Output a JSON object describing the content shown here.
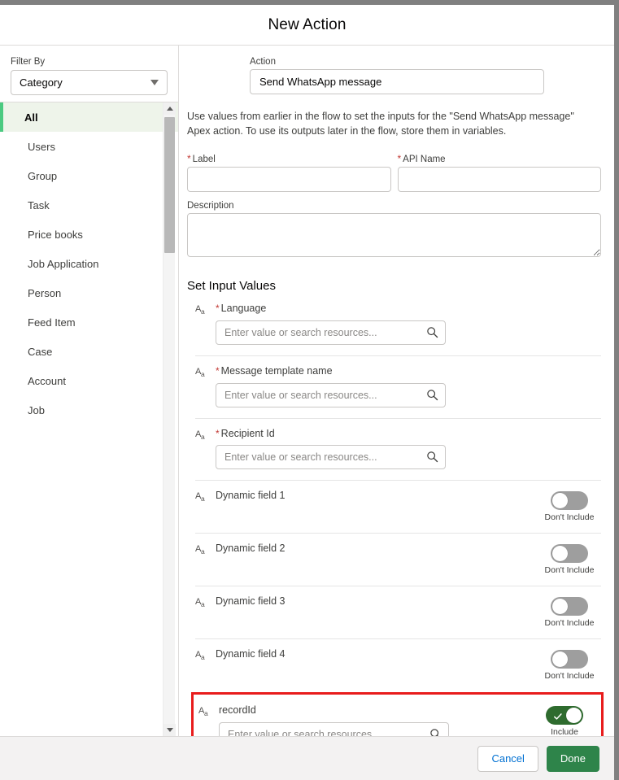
{
  "header": {
    "title": "New Action"
  },
  "sidebar": {
    "filter_label": "Filter By",
    "filter_value": "Category",
    "items": [
      {
        "label": "All",
        "selected": true
      },
      {
        "label": "Users",
        "selected": false
      },
      {
        "label": "Group",
        "selected": false
      },
      {
        "label": "Task",
        "selected": false
      },
      {
        "label": "Price books",
        "selected": false
      },
      {
        "label": "Job Application",
        "selected": false
      },
      {
        "label": "Person",
        "selected": false
      },
      {
        "label": "Feed Item",
        "selected": false
      },
      {
        "label": "Case",
        "selected": false
      },
      {
        "label": "Account",
        "selected": false
      },
      {
        "label": "Job",
        "selected": false
      }
    ]
  },
  "main": {
    "action_label": "Action",
    "action_value": "Send WhatsApp message",
    "description_text": "Use values from earlier in the flow to set the inputs for the \"Send WhatsApp message\" Apex action. To use its outputs later in the flow, store them in variables.",
    "label_field": {
      "label": "Label",
      "required_mark": "*",
      "value": ""
    },
    "api_name_field": {
      "label": "API Name",
      "required_mark": "*",
      "value": ""
    },
    "description_field": {
      "label": "Description",
      "value": ""
    },
    "section_title": "Set Input Values",
    "placeholder": "Enter value or search resources...",
    "type_icon": "text-type-icon",
    "rows": [
      {
        "label": "Language",
        "required": true,
        "has_input": true,
        "has_toggle": false,
        "toggle_on": false,
        "toggle_text": "",
        "highlighted": false
      },
      {
        "label": "Message template name",
        "required": true,
        "has_input": true,
        "has_toggle": false,
        "toggle_on": false,
        "toggle_text": "",
        "highlighted": false
      },
      {
        "label": "Recipient Id",
        "required": true,
        "has_input": true,
        "has_toggle": false,
        "toggle_on": false,
        "toggle_text": "",
        "highlighted": false
      },
      {
        "label": "Dynamic field 1",
        "required": false,
        "has_input": false,
        "has_toggle": true,
        "toggle_on": false,
        "toggle_text": "Don't Include",
        "highlighted": false
      },
      {
        "label": "Dynamic field 2",
        "required": false,
        "has_input": false,
        "has_toggle": true,
        "toggle_on": false,
        "toggle_text": "Don't Include",
        "highlighted": false
      },
      {
        "label": "Dynamic field 3",
        "required": false,
        "has_input": false,
        "has_toggle": true,
        "toggle_on": false,
        "toggle_text": "Don't Include",
        "highlighted": false
      },
      {
        "label": "Dynamic field 4",
        "required": false,
        "has_input": false,
        "has_toggle": true,
        "toggle_on": false,
        "toggle_text": "Don't Include",
        "highlighted": false
      },
      {
        "label": "recordId",
        "required": false,
        "has_input": true,
        "has_toggle": true,
        "toggle_on": true,
        "toggle_text": "Include",
        "highlighted": true
      }
    ]
  },
  "footer": {
    "cancel_label": "Cancel",
    "done_label": "Done"
  },
  "colors": {
    "brand_green": "#2e844a",
    "toggle_on_green": "#2e6b2e",
    "selected_accent": "#4bca81",
    "required_red": "#c23934",
    "highlight_red": "#e81c1c",
    "link_blue": "#0070d2"
  }
}
